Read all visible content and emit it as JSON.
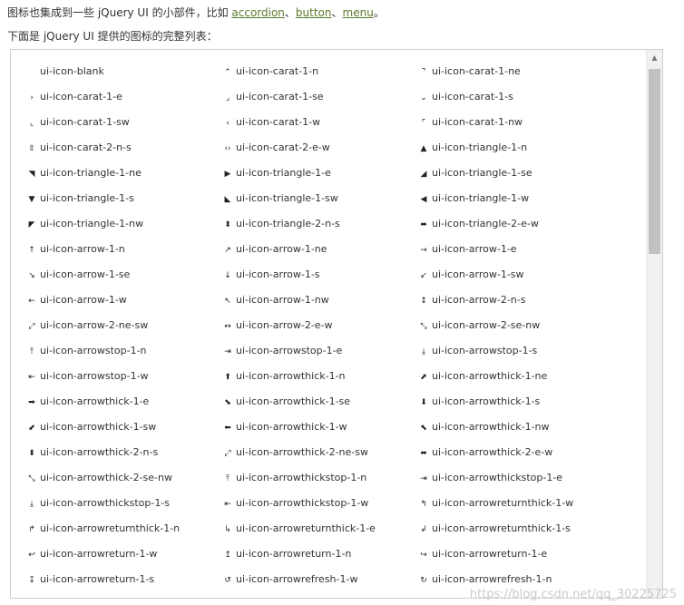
{
  "intro": {
    "prefix": "图标也集成到一些 jQuery UI 的小部件，比如 ",
    "links": [
      "accordion",
      "button",
      "menu"
    ],
    "sep": "、",
    "suffix": "。"
  },
  "list_heading": "下面是 jQuery UI 提供的图标的完整列表：",
  "icons": [
    {
      "glyph": "",
      "name": "ui-icon-blank"
    },
    {
      "glyph": "⌃",
      "name": "ui-icon-carat-1-n"
    },
    {
      "glyph": "⌝",
      "name": "ui-icon-carat-1-ne"
    },
    {
      "glyph": "›",
      "name": "ui-icon-carat-1-e"
    },
    {
      "glyph": "⌟",
      "name": "ui-icon-carat-1-se"
    },
    {
      "glyph": "⌄",
      "name": "ui-icon-carat-1-s"
    },
    {
      "glyph": "⌞",
      "name": "ui-icon-carat-1-sw"
    },
    {
      "glyph": "‹",
      "name": "ui-icon-carat-1-w"
    },
    {
      "glyph": "⌜",
      "name": "ui-icon-carat-1-nw"
    },
    {
      "glyph": "⇳",
      "name": "ui-icon-carat-2-n-s"
    },
    {
      "glyph": "‹›",
      "name": "ui-icon-carat-2-e-w"
    },
    {
      "glyph": "▲",
      "name": "ui-icon-triangle-1-n"
    },
    {
      "glyph": "◥",
      "name": "ui-icon-triangle-1-ne"
    },
    {
      "glyph": "▶",
      "name": "ui-icon-triangle-1-e"
    },
    {
      "glyph": "◢",
      "name": "ui-icon-triangle-1-se"
    },
    {
      "glyph": "▼",
      "name": "ui-icon-triangle-1-s"
    },
    {
      "glyph": "◣",
      "name": "ui-icon-triangle-1-sw"
    },
    {
      "glyph": "◀",
      "name": "ui-icon-triangle-1-w"
    },
    {
      "glyph": "◤",
      "name": "ui-icon-triangle-1-nw"
    },
    {
      "glyph": "⬍",
      "name": "ui-icon-triangle-2-n-s"
    },
    {
      "glyph": "⬌",
      "name": "ui-icon-triangle-2-e-w"
    },
    {
      "glyph": "↑",
      "name": "ui-icon-arrow-1-n"
    },
    {
      "glyph": "↗",
      "name": "ui-icon-arrow-1-ne"
    },
    {
      "glyph": "→",
      "name": "ui-icon-arrow-1-e"
    },
    {
      "glyph": "↘",
      "name": "ui-icon-arrow-1-se"
    },
    {
      "glyph": "↓",
      "name": "ui-icon-arrow-1-s"
    },
    {
      "glyph": "↙",
      "name": "ui-icon-arrow-1-sw"
    },
    {
      "glyph": "←",
      "name": "ui-icon-arrow-1-w"
    },
    {
      "glyph": "↖",
      "name": "ui-icon-arrow-1-nw"
    },
    {
      "glyph": "↕",
      "name": "ui-icon-arrow-2-n-s"
    },
    {
      "glyph": "⤢",
      "name": "ui-icon-arrow-2-ne-sw"
    },
    {
      "glyph": "↔",
      "name": "ui-icon-arrow-2-e-w"
    },
    {
      "glyph": "⤡",
      "name": "ui-icon-arrow-2-se-nw"
    },
    {
      "glyph": "⤒",
      "name": "ui-icon-arrowstop-1-n"
    },
    {
      "glyph": "⇥",
      "name": "ui-icon-arrowstop-1-e"
    },
    {
      "glyph": "⤓",
      "name": "ui-icon-arrowstop-1-s"
    },
    {
      "glyph": "⇤",
      "name": "ui-icon-arrowstop-1-w"
    },
    {
      "glyph": "⬆",
      "name": "ui-icon-arrowthick-1-n"
    },
    {
      "glyph": "⬈",
      "name": "ui-icon-arrowthick-1-ne"
    },
    {
      "glyph": "➡",
      "name": "ui-icon-arrowthick-1-e"
    },
    {
      "glyph": "⬊",
      "name": "ui-icon-arrowthick-1-se"
    },
    {
      "glyph": "⬇",
      "name": "ui-icon-arrowthick-1-s"
    },
    {
      "glyph": "⬋",
      "name": "ui-icon-arrowthick-1-sw"
    },
    {
      "glyph": "⬅",
      "name": "ui-icon-arrowthick-1-w"
    },
    {
      "glyph": "⬉",
      "name": "ui-icon-arrowthick-1-nw"
    },
    {
      "glyph": "⬍",
      "name": "ui-icon-arrowthick-2-n-s"
    },
    {
      "glyph": "⤢",
      "name": "ui-icon-arrowthick-2-ne-sw"
    },
    {
      "glyph": "⬌",
      "name": "ui-icon-arrowthick-2-e-w"
    },
    {
      "glyph": "⤡",
      "name": "ui-icon-arrowthick-2-se-nw"
    },
    {
      "glyph": "⤒",
      "name": "ui-icon-arrowthickstop-1-n"
    },
    {
      "glyph": "⇥",
      "name": "ui-icon-arrowthickstop-1-e"
    },
    {
      "glyph": "⤓",
      "name": "ui-icon-arrowthickstop-1-s"
    },
    {
      "glyph": "⇤",
      "name": "ui-icon-arrowthickstop-1-w"
    },
    {
      "glyph": "↰",
      "name": "ui-icon-arrowreturnthick-1-w"
    },
    {
      "glyph": "↱",
      "name": "ui-icon-arrowreturnthick-1-n"
    },
    {
      "glyph": "↳",
      "name": "ui-icon-arrowreturnthick-1-e"
    },
    {
      "glyph": "↲",
      "name": "ui-icon-arrowreturnthick-1-s"
    },
    {
      "glyph": "↩",
      "name": "ui-icon-arrowreturn-1-w"
    },
    {
      "glyph": "↥",
      "name": "ui-icon-arrowreturn-1-n"
    },
    {
      "glyph": "↪",
      "name": "ui-icon-arrowreturn-1-e"
    },
    {
      "glyph": "↧",
      "name": "ui-icon-arrowreturn-1-s"
    },
    {
      "glyph": "↺",
      "name": "ui-icon-arrowrefresh-1-w"
    },
    {
      "glyph": "↻",
      "name": "ui-icon-arrowrefresh-1-n"
    }
  ],
  "watermark": "https://blog.csdn.net/qq_30225725",
  "colors": {
    "link": "#5a7a2c",
    "text": "#333333",
    "border": "#cfcfcf",
    "scroll_thumb": "#c1c1c1"
  }
}
